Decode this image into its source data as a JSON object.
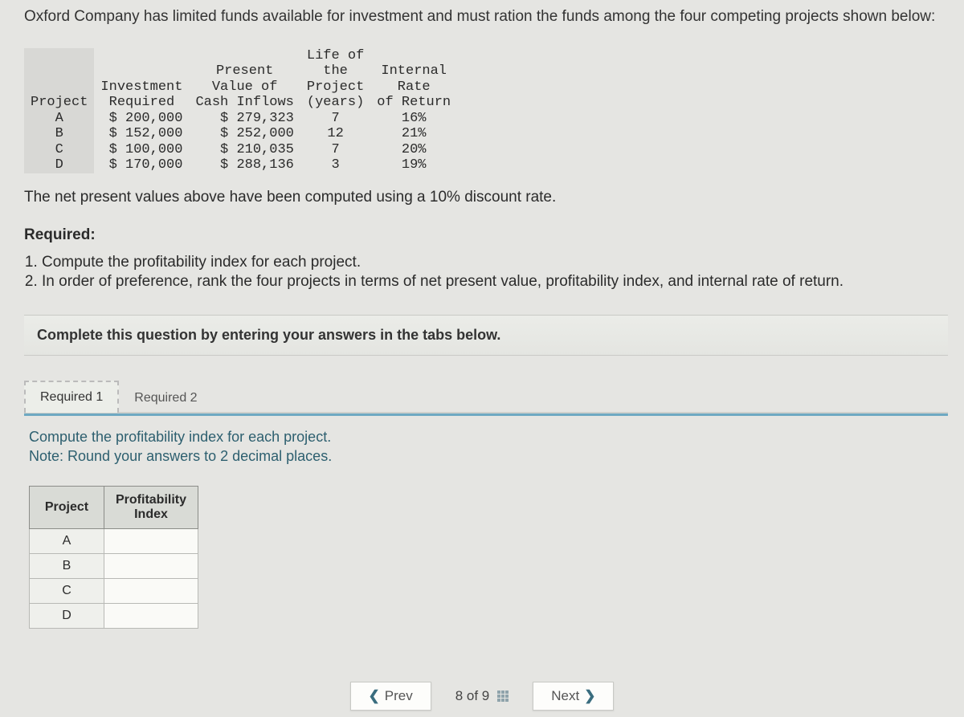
{
  "intro": "Oxford Company has limited funds available for investment and must ration the funds among the four competing projects shown below:",
  "data_headers": {
    "project": "Project",
    "investment": "Investment\nRequired",
    "pv": "Present\nValue of\nCash Inflows",
    "life": "Life of\nthe\nProject\n(years)",
    "irr": "Internal\nRate\nof Return"
  },
  "data_rows": [
    {
      "project": "A",
      "investment": "$ 200,000",
      "pv": "$ 279,323",
      "life": "7",
      "irr": "16%"
    },
    {
      "project": "B",
      "investment": "$ 152,000",
      "pv": "$ 252,000",
      "life": "12",
      "irr": "21%"
    },
    {
      "project": "C",
      "investment": "$ 100,000",
      "pv": "$ 210,035",
      "life": "7",
      "irr": "20%"
    },
    {
      "project": "D",
      "investment": "$ 170,000",
      "pv": "$ 288,136",
      "life": "3",
      "irr": "19%"
    }
  ],
  "npv_note": "The net present values above have been computed using a 10% discount rate.",
  "required_title": "Required:",
  "required_items": [
    "Compute the profitability index for each project.",
    "In order of preference, rank the four projects in terms of net present value, profitability index, and internal rate of return."
  ],
  "instruction_bar": "Complete this question by entering your answers in the tabs below.",
  "tabs": {
    "tab1": "Required 1",
    "tab2": "Required 2"
  },
  "tab_body": {
    "line1": "Compute the profitability index for each project.",
    "line2": "Note: Round your answers to 2 decimal places."
  },
  "answer_table": {
    "col1": "Project",
    "col2": "Profitability\nIndex",
    "rows": [
      "A",
      "B",
      "C",
      "D"
    ]
  },
  "nav": {
    "prev": "Prev",
    "next": "Next",
    "page": "8 of 9"
  }
}
